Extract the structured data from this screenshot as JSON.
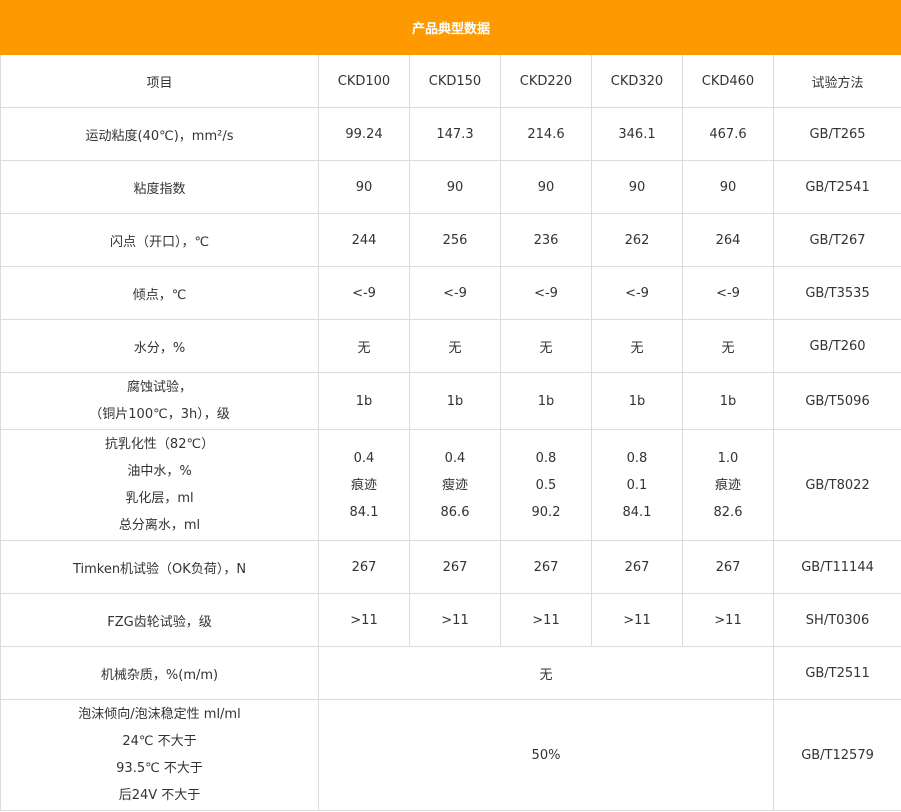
{
  "table": {
    "title": "产品典型数据",
    "headers": [
      "项目",
      "CKD100",
      "CKD150",
      "CKD220",
      "CKD320",
      "CKD460",
      "试验方法"
    ],
    "rows": [
      {
        "item": [
          "运动粘度(40℃)，mm²/s"
        ],
        "values": [
          "99.24",
          "147.3",
          "214.6",
          "346.1",
          "467.6"
        ],
        "method": "GB/T265"
      },
      {
        "item": [
          "粘度指数"
        ],
        "values": [
          "90",
          "90",
          "90",
          "90",
          "90"
        ],
        "method": "GB/T2541"
      },
      {
        "item": [
          "闪点（开口），℃"
        ],
        "values": [
          "244",
          "256",
          "236",
          "262",
          "264"
        ],
        "method": "GB/T267"
      },
      {
        "item": [
          "倾点，℃"
        ],
        "values": [
          "<-9",
          "<-9",
          "<-9",
          "<-9",
          "<-9"
        ],
        "method": "GB/T3535"
      },
      {
        "item": [
          "水分，%"
        ],
        "values": [
          "无",
          "无",
          "无",
          "无",
          "无"
        ],
        "method": "GB/T260"
      },
      {
        "item": [
          "腐蚀试验，",
          "（铜片100℃，3h），级"
        ],
        "values": [
          "1b",
          "1b",
          "1b",
          "1b",
          "1b"
        ],
        "method": "GB/T5096"
      },
      {
        "item": [
          "抗乳化性（82℃）",
          "油中水，%",
          "乳化层，ml",
          "总分离水，ml"
        ],
        "values": [
          [
            "",
            "0.4",
            "痕迹",
            "84.1"
          ],
          [
            "",
            "0.4",
            "瘦迹",
            "86.6"
          ],
          [
            "",
            "0.8",
            "0.5",
            "90.2"
          ],
          [
            "",
            "0.8",
            "0.1",
            "84.1"
          ],
          [
            "",
            "1.0",
            "痕迹",
            "82.6"
          ]
        ],
        "method": "GB/T8022"
      },
      {
        "item": [
          "Timken机试验（OK负荷），N"
        ],
        "values": [
          "267",
          "267",
          "267",
          "267",
          "267"
        ],
        "method": "GB/T11144"
      },
      {
        "item": [
          "FZG齿轮试验，级"
        ],
        "values": [
          ">11",
          ">11",
          ">11",
          ">11",
          ">11"
        ],
        "method": "SH/T0306"
      },
      {
        "item": [
          "机械杂质，%(m/m)"
        ],
        "merged_value": "无",
        "method": "GB/T2511"
      },
      {
        "item": [
          "泡沫倾向/泡沫稳定性 ml/ml",
          "24℃     不大于",
          "93.5℃     不大于",
          "后24V     不大于"
        ],
        "merged_value": "50%",
        "method": "GB/T12579"
      }
    ]
  }
}
